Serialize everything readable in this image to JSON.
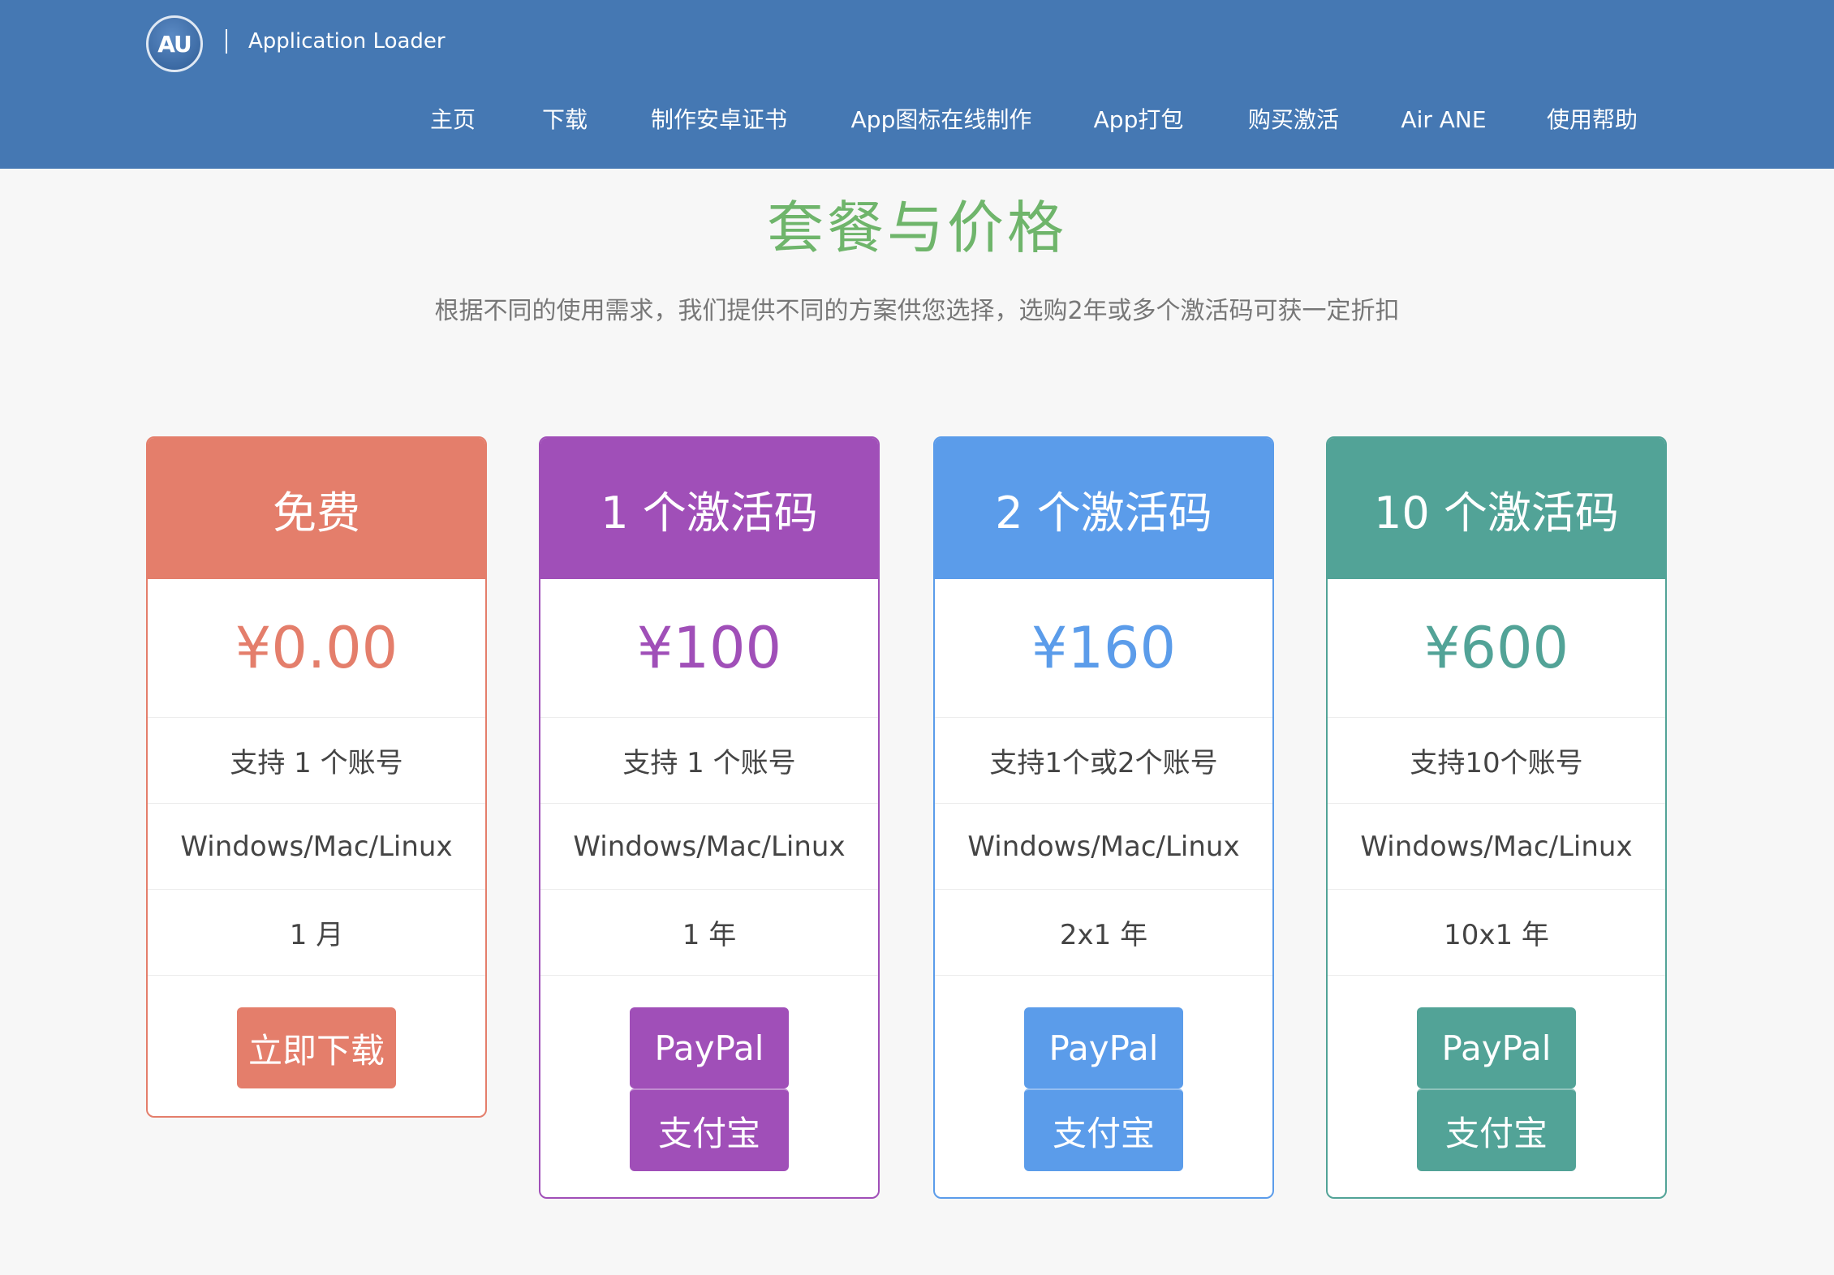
{
  "header": {
    "logo_text": "AU",
    "app_name": "Application Loader",
    "nav": [
      {
        "label": "主页"
      },
      {
        "label": "下载"
      },
      {
        "label": "制作安卓证书"
      },
      {
        "label": "App图标在线制作"
      },
      {
        "label": "App打包"
      },
      {
        "label": "购买激活"
      },
      {
        "label": "Air ANE"
      },
      {
        "label": "使用帮助"
      }
    ]
  },
  "page": {
    "title": "套餐与价格",
    "subtitle": "根据不同的使用需求，我们提供不同的方案供您选择，选购2年或多个激活码可获一定折扣"
  },
  "colors": {
    "header_bg": "#4578b3",
    "title": "#6fb56b",
    "free": "#e47e6b",
    "one": "#a04fb8",
    "two": "#5b9cea",
    "ten": "#52a397"
  },
  "plans": [
    {
      "name": "免费",
      "price": "¥0.00",
      "accounts": "支持 1 个账号",
      "platforms": "Windows/Mac/Linux",
      "duration": "1 月",
      "buttons": [
        "立即下载"
      ]
    },
    {
      "name": "1 个激活码",
      "price": "¥100",
      "accounts": "支持 1 个账号",
      "platforms": "Windows/Mac/Linux",
      "duration": "1 年",
      "buttons": [
        "PayPal",
        "支付宝"
      ]
    },
    {
      "name": "2 个激活码",
      "price": "¥160",
      "accounts": "支持1个或2个账号",
      "platforms": "Windows/Mac/Linux",
      "duration": "2x1 年",
      "buttons": [
        "PayPal",
        "支付宝"
      ]
    },
    {
      "name": "10 个激活码",
      "price": "¥600",
      "accounts": "支持10个账号",
      "platforms": "Windows/Mac/Linux",
      "duration": "10x1 年",
      "buttons": [
        "PayPal",
        "支付宝"
      ]
    }
  ]
}
